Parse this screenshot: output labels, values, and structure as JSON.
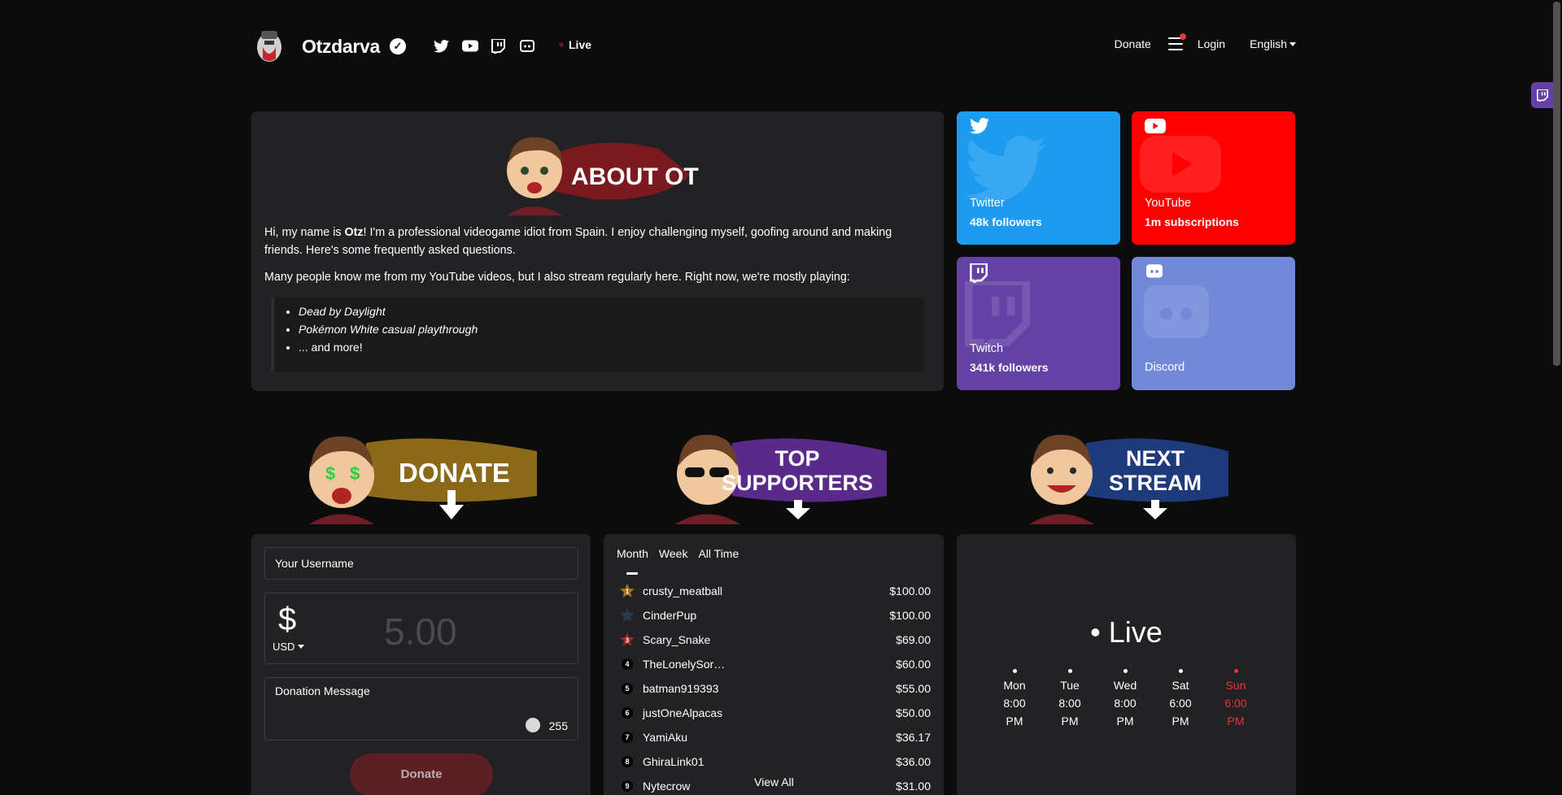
{
  "header": {
    "brand": "Otzdarva",
    "verified_mark": "✓",
    "social_icons": [
      "twitter-icon",
      "youtube-icon",
      "twitch-icon",
      "discord-icon"
    ],
    "live_label": "Live",
    "nav": {
      "donate": "Donate",
      "login": "Login",
      "language": "English"
    }
  },
  "about": {
    "banner_text": "ABOUT OTZ",
    "p1_a": "Hi, my name is ",
    "p1_name": "Otz",
    "p1_b": "! I'm a professional videogame idiot from Spain. I enjoy challenging myself, goofing around and making friends. Here's some ",
    "p1_link": "frequently asked questions",
    "p1_c": ".",
    "p2_a": "Many people know me from my ",
    "p2_link": "YouTube videos",
    "p2_b": ", but I also stream regularly here. Right now, we're mostly playing:",
    "games": [
      "Dead by Daylight",
      "Pokémon White casual playthrough",
      "... and more!"
    ]
  },
  "tiles": {
    "twitter": {
      "name": "Twitter",
      "count": "48k followers",
      "color": "#1d9bf0"
    },
    "youtube": {
      "name": "YouTube",
      "count": "1m subscriptions",
      "color": "#ff0000"
    },
    "twitch": {
      "name": "Twitch",
      "count": "341k followers",
      "color": "#6441a5"
    },
    "discord": {
      "name": "Discord",
      "color": "#7289da"
    }
  },
  "banners": {
    "donate": "DONATE",
    "top_line1": "TOP",
    "top_line2": "SUPPORTERS",
    "next_line1": "NEXT",
    "next_line2": "STREAM"
  },
  "donate_form": {
    "username_placeholder": "Your Username",
    "currency_symbol": "$",
    "currency": "USD",
    "amount_placeholder": "5.00",
    "message_placeholder": "Donation Message",
    "char_count": "255",
    "button": "Donate"
  },
  "supporters": {
    "tabs": [
      "Month",
      "Week",
      "All Time"
    ],
    "rows": [
      {
        "rank": "1",
        "name": "crusty_meatball",
        "amount": "$100.00"
      },
      {
        "rank": "",
        "name": "CinderPup",
        "amount": "$100.00"
      },
      {
        "rank": "3",
        "name": "Scary_Snake",
        "amount": "$69.00"
      },
      {
        "rank": "4",
        "name": "TheLonelySor…",
        "amount": "$60.00"
      },
      {
        "rank": "5",
        "name": "batman919393",
        "amount": "$55.00"
      },
      {
        "rank": "6",
        "name": "justOneAlpacas",
        "amount": "$50.00"
      },
      {
        "rank": "7",
        "name": "YamiAku",
        "amount": "$36.17"
      },
      {
        "rank": "8",
        "name": "GhiraLink01",
        "amount": "$36.00"
      },
      {
        "rank": "9",
        "name": "Nytecrow",
        "amount": "$31.00"
      }
    ],
    "view_all": "View All"
  },
  "next_stream": {
    "live": "• Live",
    "schedule": [
      {
        "day": "Mon",
        "time": "8:00 PM"
      },
      {
        "day": "Tue",
        "time": "8:00 PM"
      },
      {
        "day": "Wed",
        "time": "8:00 PM"
      },
      {
        "day": "Sat",
        "time": "6:00 PM"
      },
      {
        "day": "Sun",
        "time": "6:00 PM",
        "today": true
      }
    ],
    "today_color": "#e2383a"
  }
}
